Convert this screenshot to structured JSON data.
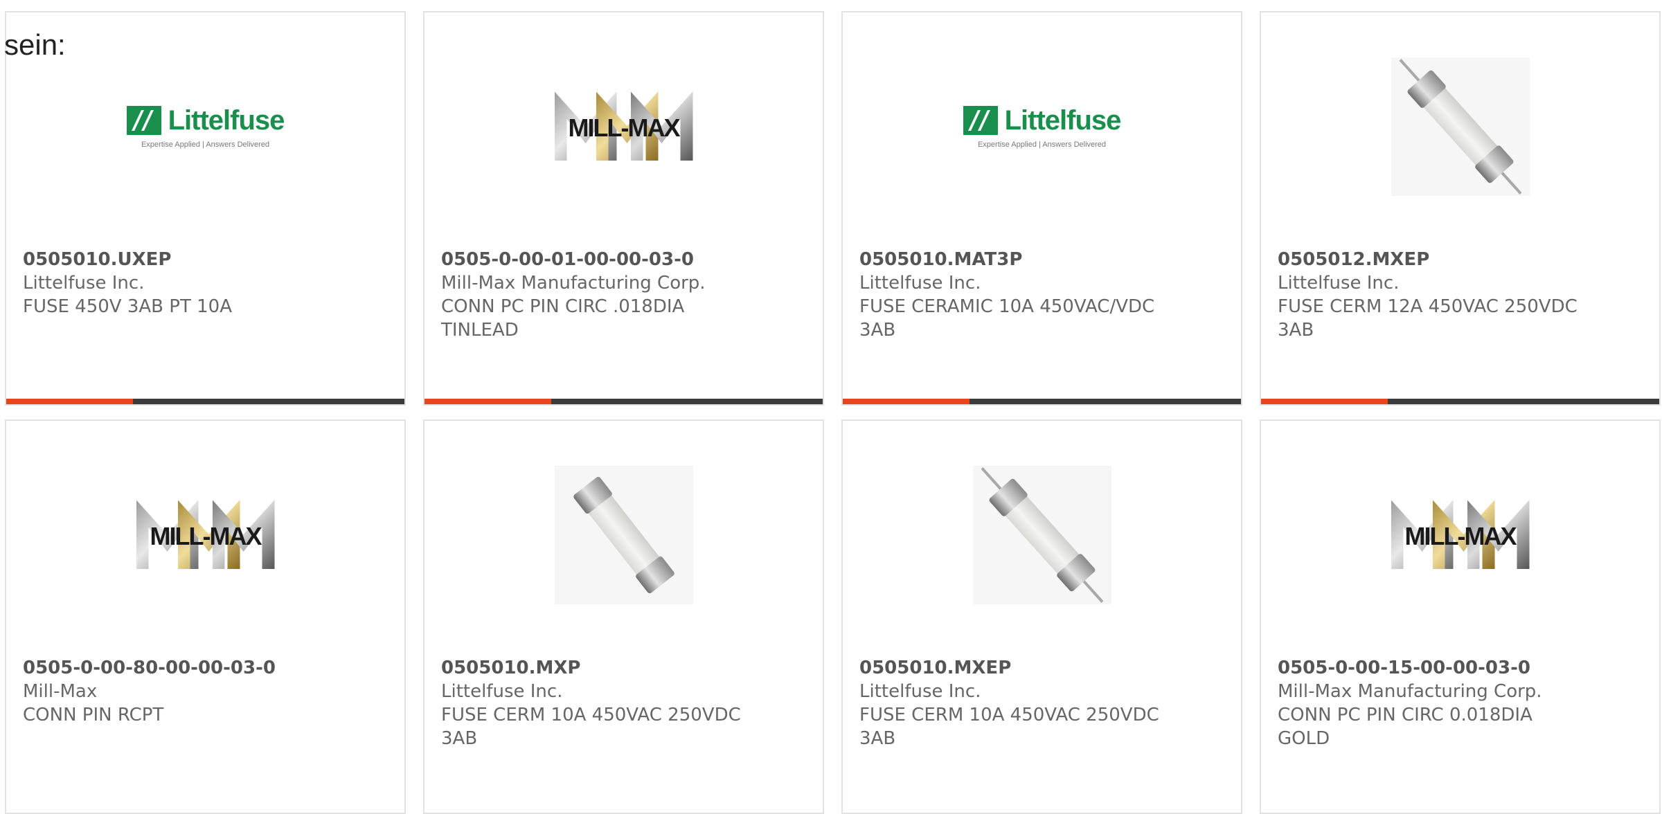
{
  "intro_text": "sein:",
  "colors": {
    "accent": "#e8441d",
    "bar": "#3b3b3b",
    "littelfuse_green": "#1a8f4d"
  },
  "logos": {
    "littelfuse": {
      "name": "Littelfuse",
      "tagline": "Expertise Applied | Answers Delivered"
    },
    "millmax": {
      "name": "MILL-MAX"
    }
  },
  "cards": [
    {
      "part": "0505010.UXEP",
      "manufacturer": "Littelfuse Inc.",
      "description": "FUSE 450V 3AB PT 10A",
      "image": "littelfuse-logo"
    },
    {
      "part": "0505-0-00-01-00-00-03-0",
      "manufacturer": "Mill-Max Manufacturing Corp.",
      "description": "CONN PC PIN CIRC .018DIA TINLEAD",
      "image": "millmax-logo"
    },
    {
      "part": "0505010.MAT3P",
      "manufacturer": "Littelfuse Inc.",
      "description": "FUSE CERAMIC 10A 450VAC/VDC 3AB",
      "image": "littelfuse-logo"
    },
    {
      "part": "0505012.MXEP",
      "manufacturer": "Littelfuse Inc.",
      "description": "FUSE CERM 12A 450VAC 250VDC 3AB",
      "image": "fuse-photo"
    },
    {
      "part": "0505-0-00-80-00-00-03-0",
      "manufacturer": "Mill-Max",
      "description": "CONN PIN RCPT",
      "image": "millmax-logo"
    },
    {
      "part": "0505010.MXP",
      "manufacturer": "Littelfuse Inc.",
      "description": "FUSE CERM 10A 450VAC 250VDC 3AB",
      "image": "fuse-photo"
    },
    {
      "part": "0505010.MXEP",
      "manufacturer": "Littelfuse Inc.",
      "description": "FUSE CERM 10A 450VAC 250VDC 3AB",
      "image": "fuse-photo"
    },
    {
      "part": "0505-0-00-15-00-00-03-0",
      "manufacturer": "Mill-Max Manufacturing Corp.",
      "description": "CONN PC PIN CIRC 0.018DIA GOLD",
      "image": "millmax-logo"
    }
  ]
}
